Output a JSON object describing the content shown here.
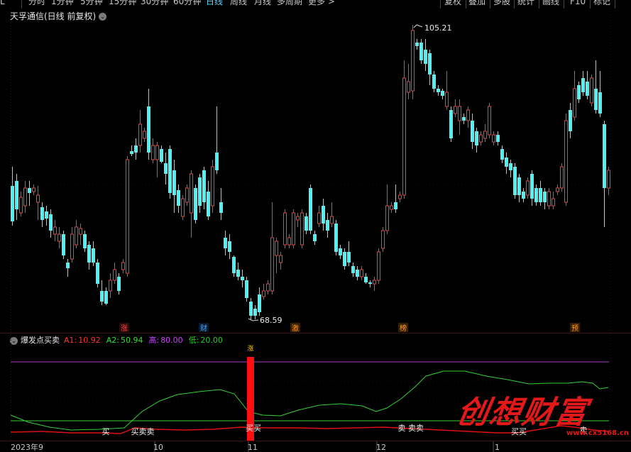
{
  "toolbar": {
    "periods": [
      "分时",
      "1分钟",
      "5分钟",
      "15分钟",
      "30分钟",
      "60分钟",
      "日线",
      "周线",
      "月线",
      "多周期",
      "更多 >"
    ],
    "active_period": "日线",
    "right_buttons": [
      "复权",
      "叠加",
      "多股",
      "统计",
      "画线",
      "F10",
      "标记"
    ]
  },
  "chart_title": "天孚通信(日线 前复权)",
  "dropdown_glyph": "⌄",
  "price_labels": {
    "high": "105.21",
    "low": "68.59"
  },
  "event_tags": [
    "涨",
    "财",
    "激",
    "榜",
    "预"
  ],
  "indicator": {
    "name": "爆发点买卖",
    "a1_label": "A1:",
    "a1_value": "10.92",
    "a2_label": "A2:",
    "a2_value": "50.94",
    "high_label": "高:",
    "high_value": "80.00",
    "low_label": "低:",
    "low_value": "20.00",
    "signal_top": "涨",
    "signals": [
      "买",
      "买卖卖",
      "买买",
      "卖",
      "卖卖",
      "买买",
      "卖"
    ]
  },
  "x_axis": [
    "2023年9",
    "10",
    "11",
    "12",
    "1"
  ],
  "watermark": "创想财富",
  "watermark_url": "www.cx5168.cn",
  "colors": {
    "up": "#ff3a3a",
    "down": "#54f0f0",
    "magenta": "#b238ce",
    "green_line": "#36d136",
    "red_line": "#e01010"
  }
}
